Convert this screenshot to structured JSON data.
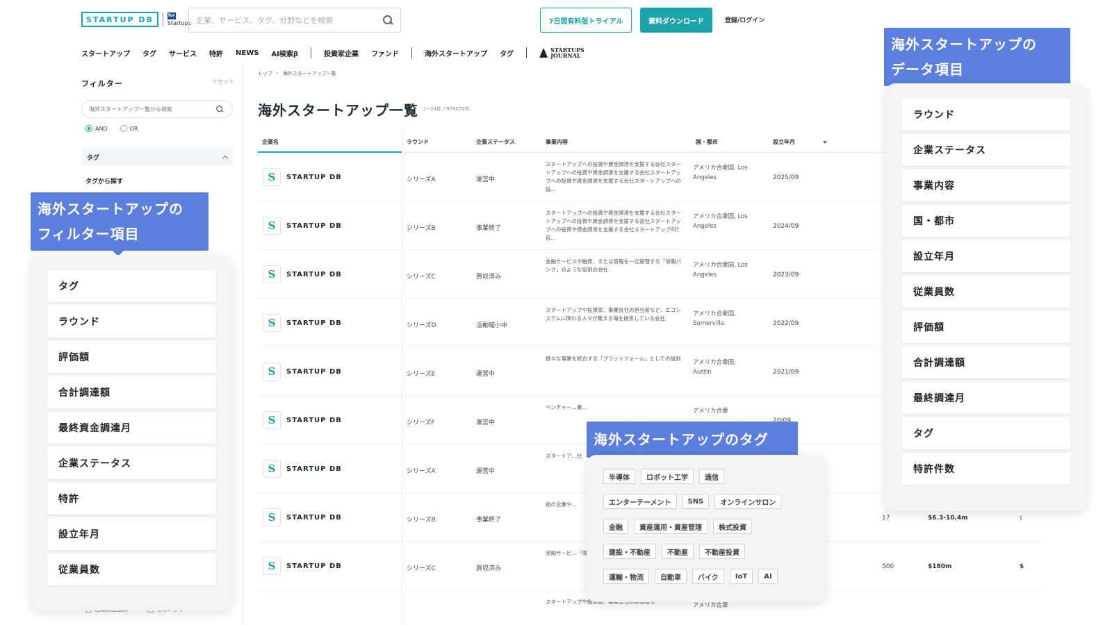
{
  "header": {
    "logo_text": "STARTUP DB",
    "logo_sub": "Startups",
    "logo_sub_badge": "for",
    "search_placeholder": "企業、サービス、タグ、分野などを検索",
    "trial_button": "7日間有料版トライアル",
    "download_button": "資料ダウンロード",
    "login": "登録/ログイン"
  },
  "nav": {
    "items_a": [
      "スタートアップ",
      "タグ",
      "サービス",
      "特許",
      "NEWS",
      "AI検索β"
    ],
    "items_b": [
      "投資家企業",
      "ファンド"
    ],
    "items_c": [
      "海外スタートアップ",
      "タグ"
    ],
    "journal_top": "STARTUPS",
    "journal_bottom": "JOURNAL"
  },
  "sidebar": {
    "title": "フィルター",
    "reset": "リセット",
    "search_placeholder": "海外スタートアップ一覧から検索",
    "radio_and": "AND",
    "radio_or": "OR",
    "tag_section": "タグ",
    "tag_search_label": "タグから探す",
    "bottom_check_1": "運転資金融資",
    "bottom_check_2": "セカンダリー"
  },
  "breadcrumb": {
    "home": "トップ",
    "sep": "›",
    "current": "海外スタートアップ一覧"
  },
  "page": {
    "title": "海外スタートアップ一覧",
    "count": "1~24件 / 974070件"
  },
  "table": {
    "headers": {
      "company": "企業名",
      "round": "ラウンド",
      "status": "企業ステータス",
      "desc": "事業内容",
      "country": "国・都市",
      "year": "設立年月"
    },
    "rows": [
      {
        "company": "STARTUP DB",
        "round": "シリーズA",
        "status": "運営中",
        "desc": "スタートアップへの投資や資金調達を支援する会社スタートアップへの投資や資金調達を支援する会社スタートアップへの投資や資金調達を支援する会社スタートアップへの投…",
        "country": "アメリカ合衆国, Los Angeles",
        "year": "2025/09",
        "emp": "",
        "val": "",
        "last": ""
      },
      {
        "company": "STARTUP DB",
        "round": "シリーズB",
        "status": "事業終了",
        "desc": "スタートアップへの投資や資金調達を支援する会社スタートアップへの投資や資金調達を支援する会社スタートアップへの投資や資金調達を支援する会社スタートアップ4行目…",
        "country": "アメリカ合衆国, Los Angeles",
        "year": "2024/09",
        "emp": "",
        "val": "",
        "last": ""
      },
      {
        "company": "STARTUP DB",
        "round": "シリーズC",
        "status": "買収済み",
        "desc": "金融サービスや融資、または情報を一元管理する「情報バンク」のような役割の会社",
        "country": "アメリカ合衆国, Los Angeles",
        "year": "2023/09",
        "emp": "",
        "val": "",
        "last": ""
      },
      {
        "company": "STARTUP DB",
        "round": "シリーズD",
        "status": "活動縮小中",
        "desc": "スタートアップや投資家、事業会社の担当者など、エコシステムに関わる人々が集まる場を提供している会社",
        "country": "アメリカ合衆国, Somerville",
        "year": "2022/09",
        "emp": "",
        "val": "",
        "last": ""
      },
      {
        "company": "STARTUP DB",
        "round": "シリーズE",
        "status": "運営中",
        "desc": "様々な事業を統合する「プラットフォーム」としての役割",
        "country": "アメリカ合衆国, Austin",
        "year": "2021/09",
        "emp": "",
        "val": "",
        "last": ""
      },
      {
        "company": "STARTUP DB",
        "round": "シリーズF",
        "status": "運営中",
        "desc": "ベンチャー…業…",
        "country": "アメリカ合衆",
        "year": "20/09",
        "emp": "",
        "val": "",
        "last": ""
      },
      {
        "company": "STARTUP DB",
        "round": "シリーズA",
        "status": "運営中",
        "desc": "スタートア…社",
        "country": "",
        "year": "",
        "emp": "",
        "val": "",
        "last": ""
      },
      {
        "company": "STARTUP DB",
        "round": "シリーズB",
        "status": "事業終了",
        "desc": "他の企業や…",
        "country": "",
        "year": "",
        "emp": "17",
        "val": "$6.3-10.4m",
        "last": ":"
      },
      {
        "company": "STARTUP DB",
        "round": "シリーズC",
        "status": "買収済み",
        "desc": "金融サービ…「情報バン…",
        "country": "",
        "year": "",
        "emp": "500",
        "val": "$180m",
        "last": "$"
      },
      {
        "company": "",
        "round": "",
        "status": "",
        "desc": "スタートアップや投資家、事業会社の担当者な",
        "country": "アメリカ合衆",
        "year": "",
        "emp": "",
        "val": "",
        "last": ""
      }
    ]
  },
  "callouts": {
    "filter_line1": "海外スタートアップの",
    "filter_line2": "フィルター項目",
    "data_line1": "海外スタートアップの",
    "data_line2": "データ項目",
    "tag": "海外スタートアップのタグ"
  },
  "filter_items": [
    "タグ",
    "ラウンド",
    "評価額",
    "合計調達額",
    "最終資金調達月",
    "企業ステータス",
    "特許",
    "設立年月",
    "従業員数"
  ],
  "data_items": [
    "ラウンド",
    "企業ステータス",
    "事業内容",
    "国・都市",
    "設立年月",
    "従業員数",
    "評価額",
    "合計調達額",
    "最終調達月",
    "タグ",
    "特許件数"
  ],
  "tag_rows": [
    [
      "半導体",
      "ロボット工学",
      "通信"
    ],
    [
      "エンターテーメント",
      "SNS",
      "オンラインサロン"
    ],
    [
      "金融",
      "資産運用・資産管理",
      "株式投資"
    ],
    [
      "建設・不動産",
      "不動産",
      "不動産投資"
    ],
    [
      "運輸・物流",
      "自動車",
      "バイク",
      "IoT",
      "AI"
    ]
  ],
  "colors": {
    "accent": "#1aa3a8",
    "callout": "#5c7edc",
    "panel": "#f3f4f6"
  }
}
